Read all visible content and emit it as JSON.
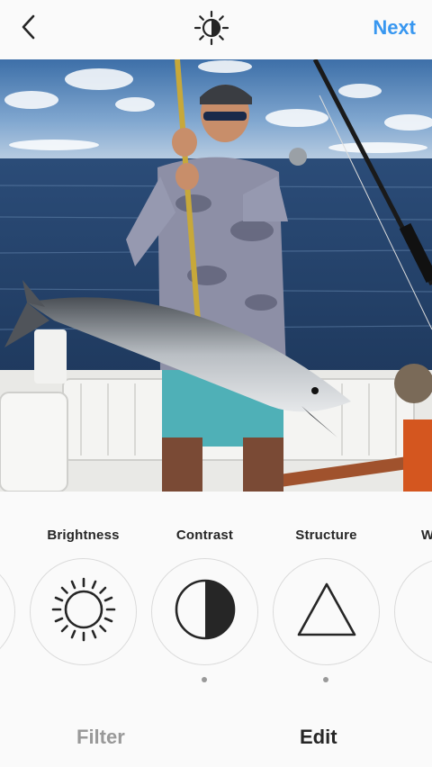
{
  "header": {
    "next_label": "Next",
    "back_icon": "chevron-left-icon",
    "lux_icon": "lux-sun-icon"
  },
  "colors": {
    "accent": "#3897f0",
    "text": "#262626",
    "muted": "#999999",
    "background": "#fafafa",
    "circle_border": "#dbdbdb"
  },
  "tools": [
    {
      "label": "",
      "icon": "adjust-icon",
      "dot": false
    },
    {
      "label": "Brightness",
      "icon": "sun-icon",
      "dot": false
    },
    {
      "label": "Contrast",
      "icon": "contrast-icon",
      "dot": true
    },
    {
      "label": "Structure",
      "icon": "triangle-icon",
      "dot": true
    },
    {
      "label": "W",
      "icon": "warmth-icon",
      "dot": false
    }
  ],
  "tabs": {
    "filter_label": "Filter",
    "edit_label": "Edit"
  }
}
